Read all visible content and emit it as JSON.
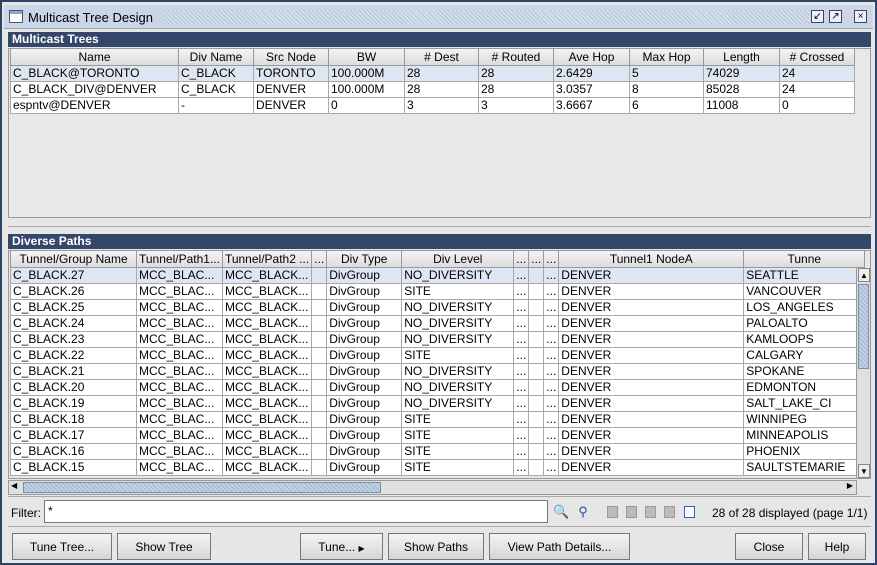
{
  "window": {
    "title": "Multicast Tree Design",
    "restore_icon": "restore-icon",
    "maximize_icon": "maximize-icon",
    "close_icon": "close-icon"
  },
  "trees": {
    "title": "Multicast Trees",
    "columns": [
      "Name",
      "Div Name",
      "Src Node",
      "BW",
      "# Dest",
      "# Routed",
      "Ave Hop",
      "Max Hop",
      "Length",
      "# Crossed"
    ],
    "rows": [
      [
        "C_BLACK@TORONTO",
        "C_BLACK",
        "TORONTO",
        "100.000M",
        "28",
        "28",
        "2.6429",
        "5",
        "74029",
        "24"
      ],
      [
        "C_BLACK_DIV@DENVER",
        "C_BLACK",
        "DENVER",
        "100.000M",
        "28",
        "28",
        "3.0357",
        "8",
        "85028",
        "24"
      ],
      [
        "espntv@DENVER",
        "-",
        "DENVER",
        "0",
        "3",
        "3",
        "3.6667",
        "6",
        "11008",
        "0"
      ]
    ]
  },
  "paths": {
    "title": "Diverse Paths",
    "columns": [
      "Tunnel/Group Name",
      "Tunnel/Path1...",
      "Tunnel/Path2 ...",
      "...",
      "Div Type",
      "Div Level",
      "...",
      "...",
      "...",
      "Tunnel1 NodeA",
      "Tunne"
    ],
    "rows": [
      [
        "C_BLACK.27",
        "MCC_BLAC...",
        "MCC_BLACK...",
        "",
        "DivGroup",
        "NO_DIVERSITY",
        "...",
        "",
        "...",
        "DENVER",
        "SEATTLE"
      ],
      [
        "C_BLACK.26",
        "MCC_BLAC...",
        "MCC_BLACK...",
        "",
        "DivGroup",
        "SITE",
        "...",
        "",
        "...",
        "DENVER",
        "VANCOUVER"
      ],
      [
        "C_BLACK.25",
        "MCC_BLAC...",
        "MCC_BLACK...",
        "",
        "DivGroup",
        "NO_DIVERSITY",
        "...",
        "",
        "...",
        "DENVER",
        "LOS_ANGELES"
      ],
      [
        "C_BLACK.24",
        "MCC_BLAC...",
        "MCC_BLACK...",
        "",
        "DivGroup",
        "NO_DIVERSITY",
        "...",
        "",
        "...",
        "DENVER",
        "PALOALTO"
      ],
      [
        "C_BLACK.23",
        "MCC_BLAC...",
        "MCC_BLACK...",
        "",
        "DivGroup",
        "NO_DIVERSITY",
        "...",
        "",
        "...",
        "DENVER",
        "KAMLOOPS"
      ],
      [
        "C_BLACK.22",
        "MCC_BLAC...",
        "MCC_BLACK...",
        "",
        "DivGroup",
        "SITE",
        "...",
        "",
        "...",
        "DENVER",
        "CALGARY"
      ],
      [
        "C_BLACK.21",
        "MCC_BLAC...",
        "MCC_BLACK...",
        "",
        "DivGroup",
        "NO_DIVERSITY",
        "...",
        "",
        "...",
        "DENVER",
        "SPOKANE"
      ],
      [
        "C_BLACK.20",
        "MCC_BLAC...",
        "MCC_BLACK...",
        "",
        "DivGroup",
        "NO_DIVERSITY",
        "...",
        "",
        "...",
        "DENVER",
        "EDMONTON"
      ],
      [
        "C_BLACK.19",
        "MCC_BLAC...",
        "MCC_BLACK...",
        "",
        "DivGroup",
        "NO_DIVERSITY",
        "...",
        "",
        "...",
        "DENVER",
        "SALT_LAKE_CI"
      ],
      [
        "C_BLACK.18",
        "MCC_BLAC...",
        "MCC_BLACK...",
        "",
        "DivGroup",
        "SITE",
        "...",
        "",
        "...",
        "DENVER",
        "WINNIPEG"
      ],
      [
        "C_BLACK.17",
        "MCC_BLAC...",
        "MCC_BLACK...",
        "",
        "DivGroup",
        "SITE",
        "...",
        "",
        "...",
        "DENVER",
        "MINNEAPOLIS"
      ],
      [
        "C_BLACK.16",
        "MCC_BLAC...",
        "MCC_BLACK...",
        "",
        "DivGroup",
        "SITE",
        "...",
        "",
        "...",
        "DENVER",
        "PHOENIX"
      ],
      [
        "C_BLACK.15",
        "MCC_BLAC...",
        "MCC_BLACK...",
        "",
        "DivGroup",
        "SITE",
        "...",
        "",
        "...",
        "DENVER",
        "SAULTSTEMARIE"
      ]
    ]
  },
  "filter": {
    "label": "Filter:",
    "value": "*",
    "status": "28 of 28 displayed (page 1/1)"
  },
  "buttons": {
    "tune_tree": "Tune Tree...",
    "show_tree": "Show Tree",
    "tune": "Tune...",
    "show_paths": "Show Paths",
    "view_path_details": "View Path Details...",
    "close": "Close",
    "help": "Help"
  }
}
